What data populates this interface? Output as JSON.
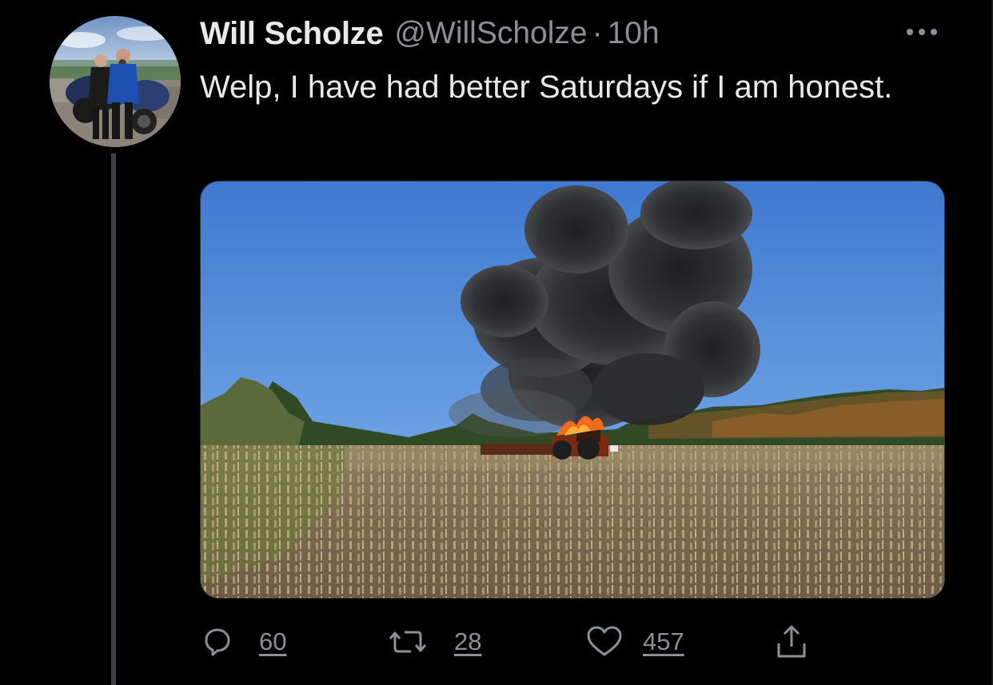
{
  "tweet": {
    "display_name": "Will Scholze",
    "handle": "@WillScholze",
    "separator": "·",
    "time": "10h",
    "text": "Welp, I have had better Saturdays if I am honest."
  },
  "actions": {
    "replies": "60",
    "retweets": "28",
    "likes": "457"
  },
  "icons": {
    "more": "more-horizontal-icon",
    "reply": "reply-icon",
    "retweet": "retweet-icon",
    "like": "heart-icon",
    "share": "share-icon"
  },
  "colors": {
    "background": "#000000",
    "text_primary": "#e7e9ea",
    "text_secondary": "#8b9096",
    "thread_line": "#3d4145"
  }
}
